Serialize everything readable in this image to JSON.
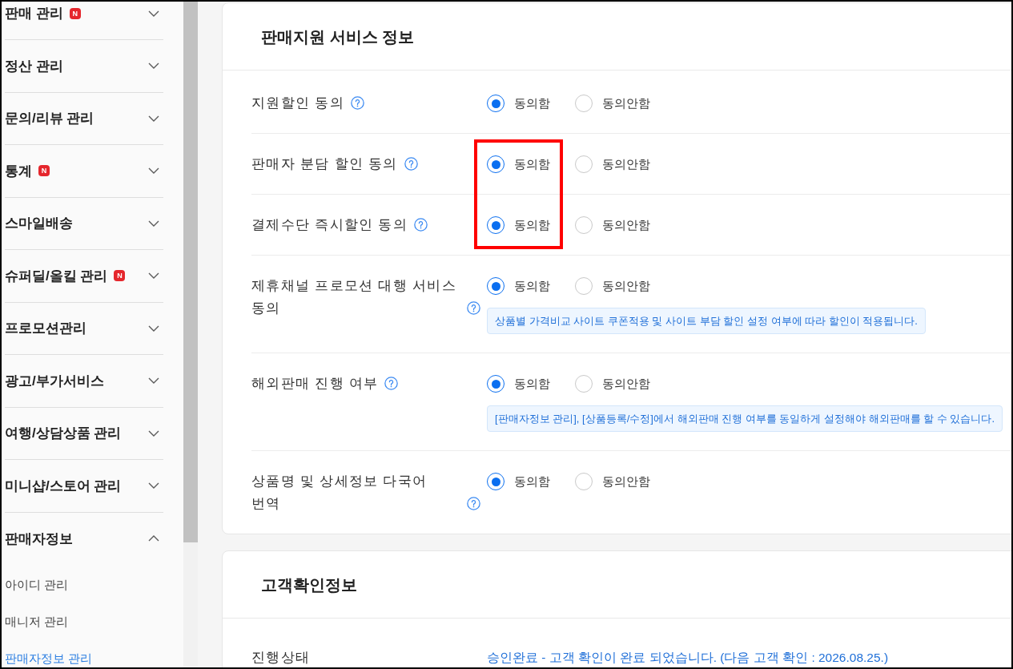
{
  "sidebar": {
    "menus": [
      {
        "label": "판매 관리",
        "badge": "N",
        "expanded": false
      },
      {
        "label": "정산 관리",
        "expanded": false
      },
      {
        "label": "문의/리뷰 관리",
        "expanded": false
      },
      {
        "label": "통계",
        "badge": "N",
        "expanded": false
      },
      {
        "label": "스마일배송",
        "expanded": false
      },
      {
        "label": "슈퍼딜/올킬 관리",
        "badge": "N",
        "expanded": false
      },
      {
        "label": "프로모션관리",
        "expanded": false
      },
      {
        "label": "광고/부가서비스",
        "expanded": false
      },
      {
        "label": "여행/상담상품 관리",
        "expanded": false
      },
      {
        "label": "미니샵/스토어 관리",
        "expanded": false
      },
      {
        "label": "판매자정보",
        "expanded": true,
        "children": [
          {
            "label": "아이디 관리",
            "selected": false
          },
          {
            "label": "매니저 관리",
            "selected": false
          },
          {
            "label": "판매자정보 관리",
            "selected": true
          }
        ]
      }
    ]
  },
  "sections": [
    {
      "title": "판매지원 서비스 정보",
      "rows": [
        {
          "kind": "radio",
          "label": "지원할인 동의",
          "help": true,
          "highlighted": false,
          "options": [
            {
              "label": "동의함",
              "selected": true
            },
            {
              "label": "동의안함",
              "selected": false
            }
          ]
        },
        {
          "kind": "radio",
          "label": "판매자 분담 할인 동의",
          "help": true,
          "highlighted": true,
          "options": [
            {
              "label": "동의함",
              "selected": true
            },
            {
              "label": "동의안함",
              "selected": false
            }
          ]
        },
        {
          "kind": "radio",
          "label": "결제수단 즉시할인 동의",
          "help": true,
          "highlighted": true,
          "options": [
            {
              "label": "동의함",
              "selected": true
            },
            {
              "label": "동의안함",
              "selected": false
            }
          ]
        },
        {
          "kind": "radio",
          "label": "제휴채널 프로모션 대행 서비스 동의",
          "help": true,
          "highlighted": false,
          "options": [
            {
              "label": "동의함",
              "selected": true
            },
            {
              "label": "동의안함",
              "selected": false
            }
          ],
          "note": "상품별 가격비교 사이트 쿠폰적용 및 사이트 부담 할인 설정 여부에 따라 할인이 적용됩니다."
        },
        {
          "kind": "radio",
          "label": "해외판매 진행 여부",
          "help": true,
          "highlighted": false,
          "options": [
            {
              "label": "동의함",
              "selected": true
            },
            {
              "label": "동의안함",
              "selected": false
            }
          ],
          "note": "[판매자정보 관리], [상품등록/수정]에서 해외판매 진행 여부를 동일하게 설정해야 해외판매를 할 수 있습니다."
        },
        {
          "kind": "radio",
          "label": "상품명 및 상세정보 다국어 번역",
          "help": true,
          "highlighted": false,
          "options": [
            {
              "label": "동의함",
              "selected": true
            },
            {
              "label": "동의안함",
              "selected": false
            }
          ]
        }
      ]
    },
    {
      "title": "고객확인정보",
      "rows": [
        {
          "kind": "status",
          "label": "진행상태",
          "value": "승인완료 - 고객 확인이 완료 되었습니다. (다음 고객 확인 : 2026.08.25.)"
        }
      ]
    }
  ]
}
